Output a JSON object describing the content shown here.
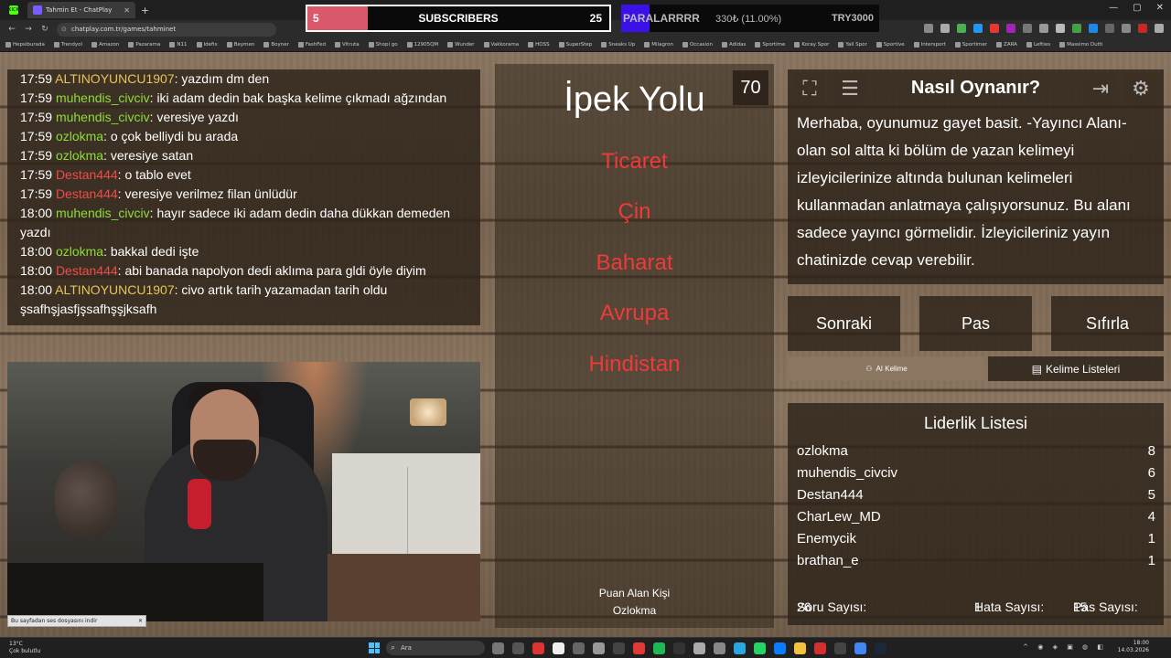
{
  "browser": {
    "tabs": [
      {
        "label": "KICK",
        "badge": true
      },
      {
        "label": "Tahmin Et - ChatPlay",
        "active": true
      }
    ],
    "url": "chatplay.com.tr/games/tahminet",
    "bookmarks": [
      "Hepsiburada",
      "Trendyol",
      "Amazon",
      "Pazarama",
      "N11",
      "Idefix",
      "Beymen",
      "Boyner",
      "FashFed",
      "Vitruta",
      "Shopi go",
      "12905QM",
      "Wunder",
      "Vakkorama",
      "HOSS",
      "SuperStep",
      "Sneaks Up",
      "Milagron",
      "Occasion",
      "Adidas",
      "Sportime",
      "Koray Spor",
      "Yali Spor",
      "Sportive",
      "Intersport",
      "Sportimer",
      "ZARA",
      "Lefties",
      "Massimo Dutti"
    ]
  },
  "overlay": {
    "subscribers": {
      "current": "5",
      "label": "SUBSCRIBERS",
      "goal": "25",
      "progress": 0.2
    },
    "donation": {
      "title": "PARALARRRR",
      "amount": "330₺ (11.00%)",
      "goal": "TRY3000",
      "progress": 0.11
    }
  },
  "chat": {
    "messages": [
      {
        "time": "17:59",
        "user": "ALTINOYUNCU1907",
        "color": "#e8c45a",
        "text": "yazdım dm den"
      },
      {
        "time": "17:59",
        "user": "muhendis_civciv",
        "color": "#8ddc3c",
        "text": "iki adam dedin bak başka kelime çıkmadı ağzından"
      },
      {
        "time": "17:59",
        "user": "muhendis_civciv",
        "color": "#8ddc3c",
        "text": "veresiye yazdı"
      },
      {
        "time": "17:59",
        "user": "ozlokma",
        "color": "#8ddc3c",
        "text": "o çok belliydi bu arada"
      },
      {
        "time": "17:59",
        "user": "ozlokma",
        "color": "#8ddc3c",
        "text": "veresiye satan"
      },
      {
        "time": "17:59",
        "user": "Destan444",
        "color": "#ef4b4b",
        "text": "o tablo evet"
      },
      {
        "time": "17:59",
        "user": "Destan444",
        "color": "#ef4b4b",
        "text": "veresiye verilmez filan ünlüdür"
      },
      {
        "time": "18:00",
        "user": "muhendis_civciv",
        "color": "#8ddc3c",
        "text": "hayır sadece iki adam dedin daha dükkan demeden yazdı"
      },
      {
        "time": "18:00",
        "user": "ozlokma",
        "color": "#8ddc3c",
        "text": "bakkal dedi işte"
      },
      {
        "time": "18:00",
        "user": "Destan444",
        "color": "#ef4b4b",
        "text": "abi banada napolyon dedi aklıma para gldi öyle diyim"
      },
      {
        "time": "18:00",
        "user": "ALTINOYUNCU1907",
        "color": "#e8c45a",
        "text": "civo artık tarih yazamadan tarih oldu şsafhşjasfjşsafhşşjksafh"
      }
    ]
  },
  "download_bar": {
    "text": "Bu sayfadan ses dosyasını indir"
  },
  "game": {
    "timer": "70",
    "word": "İpek Yolu",
    "forbidden": [
      "Ticaret",
      "Çin",
      "Baharat",
      "Avrupa",
      "Hindistan"
    ],
    "scorer_label": "Puan Alan Kişi",
    "scorer_name": "Ozlokma"
  },
  "howto": {
    "title": "Nasıl Oynanır?",
    "text": "Merhaba, oyunumuz gayet basit. -Yayıncı Alanı- olan sol altta ki bölüm de yazan kelimeyi izleyicilerinize altında bulunan kelimeleri kullanmadan anlatmaya çalışıyorsunuz. Bu alanı sadece yayıncı görmelidir. İzleyicileriniz yayın chatinizde cevap verebilir."
  },
  "actions": {
    "next": "Sonraki",
    "pass": "Pas",
    "reset": "Sıfırla",
    "ai_word": "AI Kelime",
    "word_lists": "Kelime Listeleri"
  },
  "leaderboard": {
    "title": "Liderlik Listesi",
    "rows": [
      {
        "name": "ozlokma",
        "score": "8"
      },
      {
        "name": "muhendis_civciv",
        "score": "6"
      },
      {
        "name": "Destan444",
        "score": "5"
      },
      {
        "name": "CharLew_MD",
        "score": "4"
      },
      {
        "name": "Enemycik",
        "score": "1"
      },
      {
        "name": "brathan_e",
        "score": "1"
      }
    ],
    "questions_label": "Soru Sayısı:",
    "questions": "26",
    "errors_label": "Hata Sayısı:",
    "errors": "1",
    "passes_label": "Pas Sayısı:",
    "passes": "15"
  },
  "taskbar": {
    "temp": "13°C",
    "weather": "Çok bulutlu",
    "search": "Ara",
    "time": "18:00",
    "date": "14.03.2026"
  }
}
